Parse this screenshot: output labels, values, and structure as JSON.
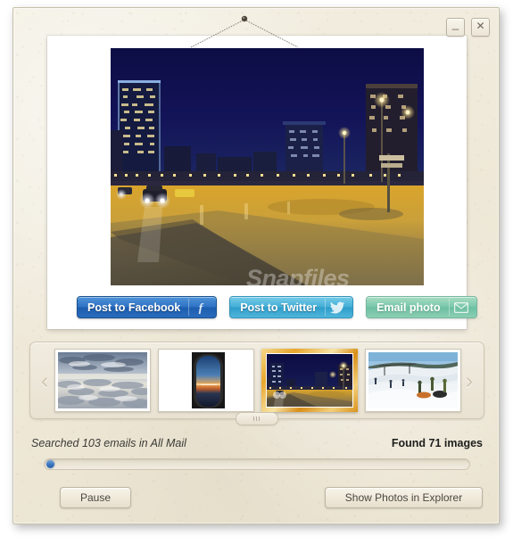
{
  "window": {
    "controls": [
      {
        "name": "minimize",
        "glyph": "_"
      },
      {
        "name": "close",
        "glyph": "✕"
      }
    ]
  },
  "photo_panel": {
    "watermark": "Snapfiles",
    "main_photo_caption": "Night city street scene with illuminated skyscrapers, car headlights and wet roadway"
  },
  "share": {
    "facebook": {
      "label": "Post to Facebook",
      "icon": "facebook-icon",
      "color": "#2f72c4"
    },
    "twitter": {
      "label": "Post to Twitter",
      "icon": "twitter-bird-icon",
      "color": "#45aed6"
    },
    "email": {
      "label": "Email photo",
      "icon": "envelope-icon",
      "color": "#79c7ab"
    }
  },
  "thumbnails": {
    "prev_icon": "chevron-left-icon",
    "next_icon": "chevron-right-icon",
    "selected_index": 2,
    "items": [
      {
        "caption": "Cloudscape seen from an aeroplane above the clouds",
        "selected": false
      },
      {
        "caption": "Sunset horizon viewed through an aeroplane window",
        "selected": false
      },
      {
        "caption": "Night city street with skyscrapers and car lights",
        "selected": true
      },
      {
        "caption": "Snowy ski slope with sledders and snowboarders",
        "selected": false
      }
    ]
  },
  "status": {
    "left_text": "Searched 103 emails in All Mail",
    "right_text": "Found 71 images",
    "emails_searched": 103,
    "mailbox": "All Mail",
    "images_found": 71,
    "progress_percent": 1
  },
  "footer": {
    "pause_label": "Pause",
    "explorer_label": "Show Photos in Explorer"
  }
}
